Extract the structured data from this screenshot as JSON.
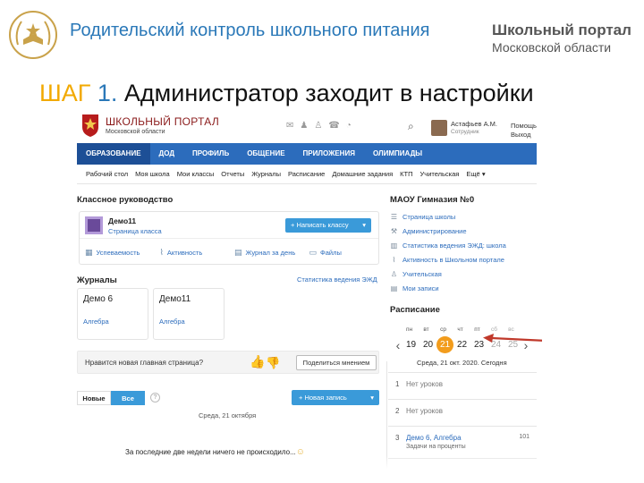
{
  "slide": {
    "title": "Родительский контроль школьного питания",
    "brand_line1": "Школьный портал",
    "brand_line2": "Московской области",
    "step_word": "ШАГ",
    "step_number": "1.",
    "step_text": " Администратор заходит в настройки"
  },
  "site": {
    "name_line1": "ШКОЛЬНЫЙ ПОРТАЛ",
    "name_line2": "Московской области",
    "user_name": "Астафьев А.М.",
    "user_role": "Сотрудник",
    "help_line1": "Помощь",
    "help_line2": "Выход",
    "nav": [
      "ОБРАЗОВАНИЕ",
      "ДОД",
      "ПРОФИЛЬ",
      "ОБЩЕНИЕ",
      "ПРИЛОЖЕНИЯ",
      "ОЛИМПИАДЫ"
    ],
    "subnav": [
      "Рабочий стол",
      "Моя школа",
      "Мои классы",
      "Отчеты",
      "Журналы",
      "Расписание",
      "Домашние задания",
      "КТП",
      "Учительская",
      "Ещё"
    ]
  },
  "class_block": {
    "title": "Классное руководство",
    "class_name": "Демо11",
    "class_link": "Страница класса",
    "write_button": "Написать классу",
    "actions": [
      "Успеваемость",
      "Активность",
      "Журнал за день",
      "Файлы"
    ]
  },
  "journals": {
    "title": "Журналы",
    "ezhd_link": "Статистика ведения ЭЖД",
    "items": [
      {
        "name": "Демо 6",
        "subject": "Алгебра"
      },
      {
        "name": "Демо11",
        "subject": "Алгебра"
      }
    ]
  },
  "feedback": {
    "question": "Нравится новая главная страница?",
    "share_button": "Поделиться мнением"
  },
  "feed": {
    "filter_new": "Новые",
    "filter_all": "Все",
    "new_post_button": "Новая запись",
    "date": "Среда, 21 октября",
    "empty_text": "За последние две недели ничего не происходило..."
  },
  "school": {
    "title": "МАОУ Гимназия №0",
    "links": [
      "Страница школы",
      "Администрирование",
      "Статистика ведения ЭЖД: школа",
      "Активность в Школьном портале",
      "Учительская",
      "Мои записи"
    ]
  },
  "schedule": {
    "title": "Расписание",
    "weekdays": [
      "пн",
      "вт",
      "ср",
      "чт",
      "пт",
      "сб",
      "вс"
    ],
    "days": [
      "19",
      "20",
      "21",
      "22",
      "23",
      "24",
      "25"
    ],
    "today_index": 2,
    "date_text": "Среда, 21 окт. 2020. Сегодня",
    "lessons": [
      {
        "num": "1",
        "text": "Нет уроков"
      },
      {
        "num": "2",
        "text": "Нет уроков"
      },
      {
        "num": "3",
        "text": "Демо 6, Алгебра",
        "sub": "Задачи на проценты",
        "room": "101"
      }
    ]
  },
  "colors": {
    "nav_blue": "#2c6cbc",
    "button_blue": "#3a9ad9",
    "today_orange": "#f29c1c",
    "step_yellow": "#f2a900",
    "title_blue": "#2a78b8",
    "arrow_red": "#c0392b"
  }
}
